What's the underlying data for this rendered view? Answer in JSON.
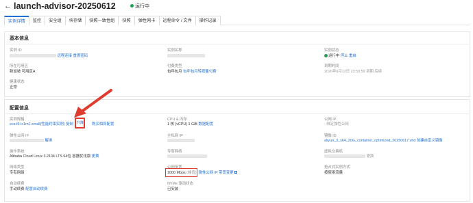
{
  "header": {
    "back_glyph": "←",
    "title": "launch-advisor-20250612",
    "status": "运行中"
  },
  "tabs": [
    {
      "label": "实例详情",
      "active": true
    },
    {
      "label": "监控"
    },
    {
      "label": "安全组"
    },
    {
      "label": "块存储"
    },
    {
      "label": "快照一致性组"
    },
    {
      "label": "快照"
    },
    {
      "label": "弹性网卡"
    },
    {
      "label": "远程命令 / 文件"
    },
    {
      "label": "操作记录"
    }
  ],
  "basic": {
    "title": "基本信息",
    "instance_id_label": "实例 ID",
    "instance_id_actions": "远程连接  重置密码",
    "instance_name_label": "实例名称",
    "instance_status_label": "实例状态",
    "instance_status_value": "运行中",
    "instance_status_actions": "停止  重启",
    "zone_label": "所在可用区",
    "zone_value": "新加坡 可用区A",
    "billing_label": "付费类型",
    "billing_value": "包年包月",
    "billing_link": "包年包月转按量付费",
    "expire_label": "到期时间",
    "expire_value": "2026年6月12日 23:59:59  到期 后续",
    "health_label": "健康状态",
    "health_value": "正常"
  },
  "config": {
    "title": "配置信息",
    "spec_label": "实例规格",
    "spec_value": "ecs.t5-lc1m1.small(性能约束实例)",
    "spec_copy": "复制",
    "spec_upgrade": "升降",
    "spec_link": "购买相同配置",
    "cpu_label": "CPU & 内存",
    "cpu_value": "1 核 (vCPU)  1 GiB",
    "cpu_link": "数据配置",
    "public_ip_label": "公网 IP",
    "public_ip_value": "- 绑定弹性公网",
    "eip_label": "弹性公网 IP",
    "eip_actions": "解绑",
    "private_ip_label": "主私网 IP",
    "image_label": "镜像 ID",
    "image_value": "aliyun_3_x64_20G_container_optimized_20250617.vhd",
    "image_link": "创建自定义镜像",
    "os_label": "操作系统",
    "os_value": "Alibaba Cloud Linux 3.2104 LTS 64位 容器优化版",
    "os_link": "更换",
    "vpc_label": "专有网络",
    "vswitch_label": "虚拟交换机",
    "vswitch_action": "更换",
    "network_type_label": "网络类型",
    "network_type_value": "专有网络",
    "bandwidth_label": "公网带宽",
    "bandwidth_value": "1000 Mbps",
    "bandwidth_suffix": "(峰值)",
    "bandwidth_link": "弹性公网 IP 带宽变更",
    "preemptible_label": "抢占式实例方式",
    "preemptible_value": "按使用流量",
    "autorenew_label": "自动续费",
    "autorenew_value": "手动续费",
    "autorenew_link": "配置自动续费",
    "nvme_label": "NVMe 驱动状态",
    "nvme_value": "已安装"
  },
  "colors": {
    "accent": "#1f6fd6",
    "highlight": "#e03b2f",
    "status_ok": "#1aa352"
  }
}
